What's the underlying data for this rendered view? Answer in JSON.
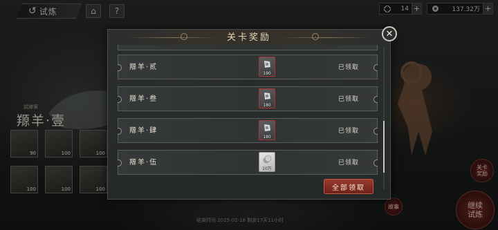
{
  "topbar": {
    "back_label": "试炼",
    "home_icon": "home-icon",
    "help_label": "?",
    "resources": [
      {
        "icon": "stamina-icon",
        "value": "14"
      },
      {
        "icon": "coin-icon",
        "value": "137.32万"
      }
    ]
  },
  "stage": {
    "subtitle": "試練第",
    "title": "羱羊·壹",
    "cards": [
      {
        "level": "90"
      },
      {
        "level": "100"
      },
      {
        "level": "100"
      },
      {
        "level": "100"
      },
      {
        "level": "100"
      },
      {
        "level": "100"
      }
    ]
  },
  "footer": {
    "date_text": "结束时间 2025-02-18 剩余17天11小时"
  },
  "side": {
    "stage_rewards_label": "关卡\n奖励",
    "story_label": "故事",
    "continue_label": "继续\n试炼"
  },
  "modal": {
    "title": "关卡奖励",
    "rows": [
      {
        "name": "羱羊·贰",
        "item_icon": "shard-icon",
        "quantity": "190",
        "status": "已领取"
      },
      {
        "name": "羱羊·叁",
        "item_icon": "shard-icon",
        "quantity": "180",
        "status": "已领取"
      },
      {
        "name": "羱羊·肆",
        "item_icon": "shard-icon",
        "quantity": "180",
        "status": "已领取"
      },
      {
        "name": "羱羊·伍",
        "item_icon": "silver-coin-icon",
        "quantity": "10万",
        "status": "已领取"
      }
    ],
    "claim_all_label": "全部领取",
    "close_label": "✕"
  },
  "colors": {
    "accent_red": "#9a3a2e",
    "item_frame_red": "#b03232",
    "title_gold": "#e9d9b8"
  }
}
